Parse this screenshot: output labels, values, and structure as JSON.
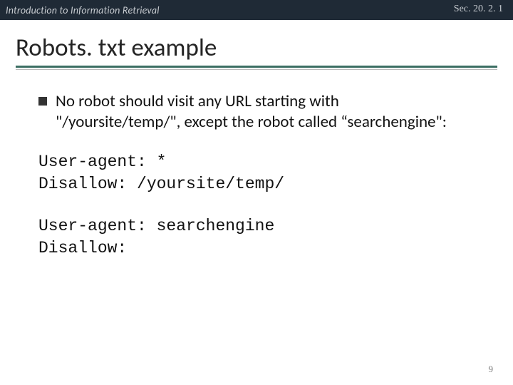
{
  "header": {
    "course": "Introduction to Information Retrieval",
    "section": "Sec. 20. 2. 1"
  },
  "title": "Robots. txt example",
  "bullet": {
    "text": "No robot should visit any URL starting with \"/yoursite/temp/\", except the robot called “searchengine\":"
  },
  "code": {
    "block1": {
      "line1": "User-agent: *",
      "line2": "Disallow: /yoursite/temp/"
    },
    "block2": {
      "line1": "User-agent: searchengine",
      "line2": "Disallow:"
    }
  },
  "page_number": "9"
}
